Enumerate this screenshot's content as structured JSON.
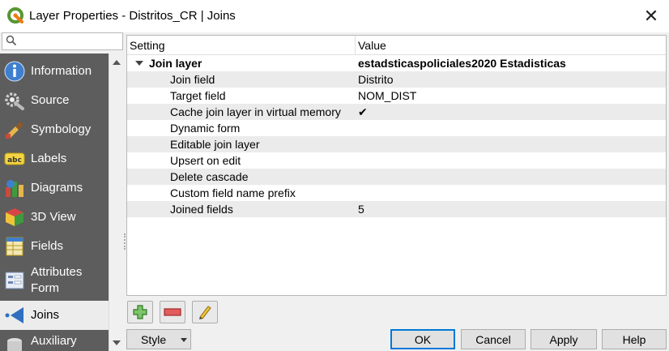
{
  "window": {
    "title": "Layer Properties - Distritos_CR | Joins",
    "close_symbol": "✕"
  },
  "search": {
    "placeholder": "",
    "value": ""
  },
  "sidebar": {
    "items": [
      {
        "label": "Information",
        "icon": "information-icon"
      },
      {
        "label": "Source",
        "icon": "source-icon"
      },
      {
        "label": "Symbology",
        "icon": "symbology-icon"
      },
      {
        "label": "Labels",
        "icon": "labels-icon"
      },
      {
        "label": "Diagrams",
        "icon": "diagrams-icon"
      },
      {
        "label": "3D View",
        "icon": "3d-view-icon"
      },
      {
        "label": "Fields",
        "icon": "fields-icon"
      },
      {
        "label": "Attributes",
        "label2": "Form",
        "icon": "attributes-form-icon"
      },
      {
        "label": "Joins",
        "icon": "joins-icon",
        "active": true
      },
      {
        "label": "Auxiliary",
        "icon": "auxiliary-icon"
      }
    ],
    "labels_badge": "abc"
  },
  "tree": {
    "headers": {
      "setting": "Setting",
      "value": "Value"
    },
    "group": {
      "setting": "Join layer",
      "value": "estadsticaspoliciales2020 Estadisticas"
    },
    "rows": [
      {
        "setting": "Join field",
        "value": "Distrito"
      },
      {
        "setting": "Target field",
        "value": "NOM_DIST"
      },
      {
        "setting": "Cache join layer in virtual memory",
        "value": "✔"
      },
      {
        "setting": "Dynamic form",
        "value": ""
      },
      {
        "setting": "Editable join layer",
        "value": ""
      },
      {
        "setting": "Upsert on edit",
        "value": ""
      },
      {
        "setting": "Delete cascade",
        "value": ""
      },
      {
        "setting": "Custom field name prefix",
        "value": ""
      },
      {
        "setting": "Joined fields",
        "value": "5"
      }
    ]
  },
  "toolbar": {
    "add": "add-join-icon",
    "remove": "remove-join-icon",
    "edit": "edit-join-icon"
  },
  "buttons": {
    "style": "Style",
    "ok": "OK",
    "cancel": "Cancel",
    "apply": "Apply",
    "help": "Help"
  },
  "colors": {
    "sidebar_bg": "#5d5d5d",
    "active_item_bg": "#ececec",
    "default_button_border": "#0078d7",
    "qgis_green": "#589632"
  }
}
